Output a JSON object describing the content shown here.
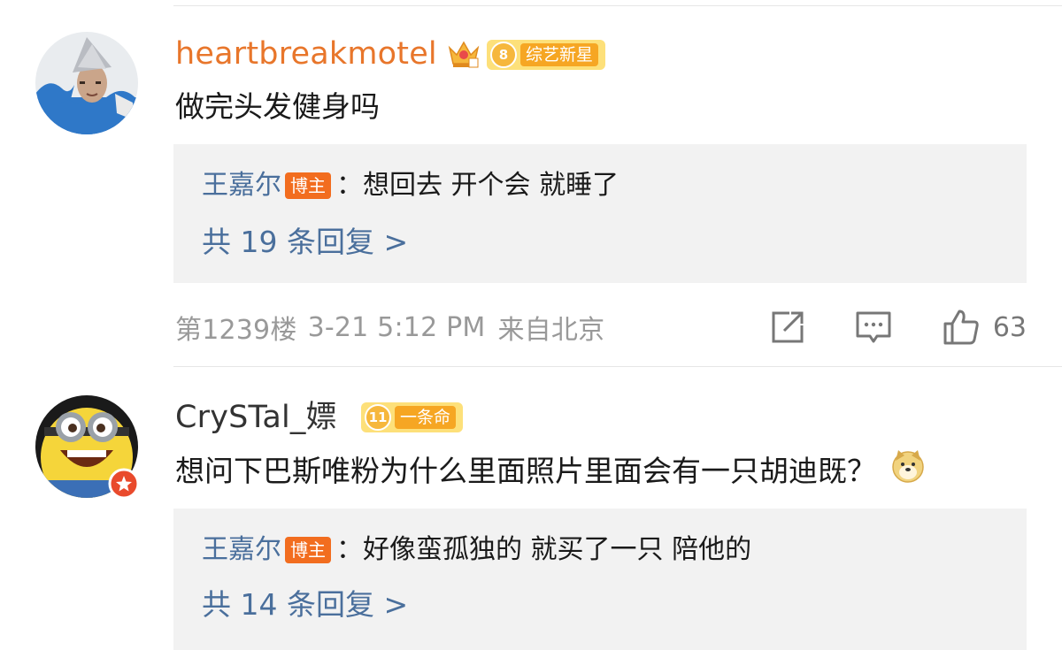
{
  "comments": [
    {
      "username": "heartbreakmotel",
      "username_color": "#e8762b",
      "badge_level": "8",
      "badge_label": "综艺新星",
      "text": "做完头发健身吗",
      "reply": {
        "author": "王嘉尔",
        "owner_tag": "博主",
        "separator": "：",
        "text": "想回去 开个会 就睡了",
        "count_text": "共 19 条回复 >"
      },
      "floor": "第1239楼",
      "time": "3-21 5:12 PM",
      "source": "来自北京",
      "likes": "63"
    },
    {
      "username": "CrySTal_嫖",
      "username_color": "#333333",
      "badge_level": "11",
      "badge_label": "一条命",
      "text": "想问下巴斯唯粉为什么里面照片里面会有一只胡迪既？",
      "emoji": "doge-icon",
      "reply": {
        "author": "王嘉尔",
        "owner_tag": "博主",
        "separator": "：",
        "text": "好像蛮孤独的 就买了一只 陪他的",
        "count_text": "共 14 条回复 >"
      }
    }
  ],
  "colors": {
    "link": "#4a6f9c",
    "owner_tag": "#f26d1f",
    "meta": "#999999",
    "reply_bg": "#f2f2f2"
  }
}
